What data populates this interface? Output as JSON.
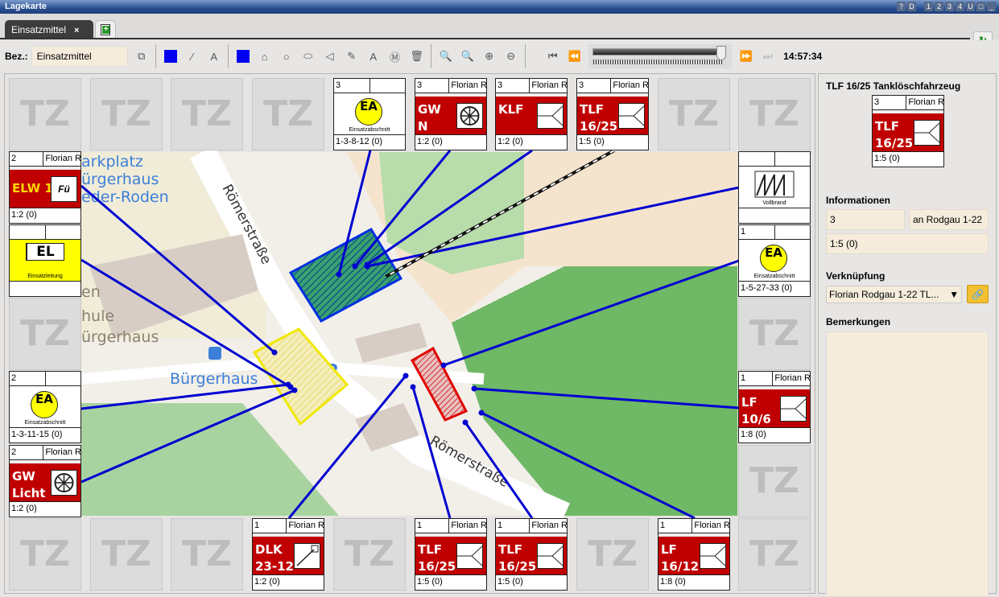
{
  "window": {
    "title": "Lagekarte",
    "buttons": [
      "?",
      "D",
      "1",
      "2",
      "3",
      "4",
      "U",
      "□",
      "_"
    ]
  },
  "tabs": [
    {
      "label": "Einsatzmittel",
      "close": "×"
    }
  ],
  "toolbar": {
    "bez_label": "Bez.:",
    "bez_value": "Einsatzmittel",
    "time": "14:57:34",
    "timeline_position_pct": 96,
    "icons": [
      "copy-add",
      "fill-color",
      "line-style",
      "text-style",
      "fill-color-2",
      "add-house",
      "add-circle",
      "add-ellipse",
      "add-triangle",
      "add-pen",
      "add-text",
      "add-marker",
      "delete",
      "zoom-fit",
      "zoom-1to1",
      "zoom-in",
      "zoom-out"
    ]
  },
  "grid": {
    "top": [
      {
        "t": "tz"
      },
      {
        "t": "tz"
      },
      {
        "t": "tz"
      },
      {
        "t": "tz"
      },
      {
        "t": "ea",
        "num": "3",
        "sub": "Einsatzabschnitt",
        "label": "EA",
        "foot": "1-3-8-12 (0)"
      },
      {
        "t": "veh",
        "num": "3",
        "unit": "Florian R",
        "name": "GW\nN",
        "sym": "wheel",
        "foot": "1:2 (0)"
      },
      {
        "t": "veh",
        "num": "3",
        "unit": "Florian R",
        "name": "KLF",
        "sym": "pump",
        "foot": "1:2 (0)"
      },
      {
        "t": "veh",
        "num": "3",
        "unit": "Florian R",
        "name": "TLF\n16/25",
        "sym": "pump",
        "foot": "1:5 (0)"
      },
      {
        "t": "tz"
      },
      {
        "t": "tz"
      }
    ],
    "left": [
      {
        "t": "veh",
        "num": "2",
        "unit": "Florian R",
        "name": "ELW 1",
        "sym": "fu",
        "symtext": "Fü",
        "foot": "1:2 (0)"
      },
      {
        "t": "el",
        "label": "EL",
        "sub": "Einsatzleitung"
      },
      {
        "t": "tz"
      },
      {
        "t": "ea",
        "num": "2",
        "sub": "Einsatzabschnitt",
        "label": "EA",
        "foot": "1-3-11-15 (0)"
      },
      {
        "t": "veh",
        "num": "2",
        "unit": "Florian R",
        "name": "GW\nLicht",
        "sym": "wheel",
        "foot": "1:2 (0)"
      }
    ],
    "right": [
      {
        "t": "fire",
        "sub": "Vollbrand"
      },
      {
        "t": "ea",
        "num": "1",
        "sub": "Einsatzabschnitt",
        "label": "EA",
        "foot": "1-5-27-33 (0)"
      },
      {
        "t": "tz"
      },
      {
        "t": "veh",
        "num": "1",
        "unit": "Florian R",
        "name": "LF\n10/6",
        "sym": "pump",
        "foot": "1:8 (0)"
      },
      {
        "t": "tz"
      }
    ],
    "bottom": [
      {
        "t": "tz"
      },
      {
        "t": "tz"
      },
      {
        "t": "tz"
      },
      {
        "t": "veh",
        "num": "1",
        "unit": "Florian R",
        "name": "DLK\n23-12",
        "sym": "ladder",
        "foot": "1:2 (0)"
      },
      {
        "t": "tz"
      },
      {
        "t": "veh",
        "num": "1",
        "unit": "Florian R",
        "name": "TLF\n16/25",
        "sym": "pump",
        "foot": "1:5 (0)"
      },
      {
        "t": "veh",
        "num": "1",
        "unit": "Florian R",
        "name": "TLF\n16/25",
        "sym": "pump",
        "foot": "1:5 (0)"
      },
      {
        "t": "tz"
      },
      {
        "t": "veh",
        "num": "1",
        "unit": "Florian R",
        "name": "LF\n16/12",
        "sym": "pump",
        "foot": "1:8 (0)"
      },
      {
        "t": "tz"
      }
    ],
    "tz_label": "TZ"
  },
  "map": {
    "labels": [
      "arkplatz",
      "ürgerhaus",
      "eder-Roden",
      "Römerstraße",
      "Römerstraße",
      "Bürgerhaus",
      "P",
      "hule",
      "ürgerhaus",
      "en"
    ]
  },
  "side": {
    "title": "TLF 16/25 Tanklöschfahrzeug",
    "card": {
      "t": "veh",
      "num": "3",
      "unit": "Florian R",
      "name": "TLF\n16/25",
      "sym": "pump",
      "foot": "1:5 (0)"
    },
    "info_label": "Informationen",
    "info_num": "3",
    "info_unit": "an Rodgau 1-22",
    "info_strength": "1:5 (0)",
    "link_label": "Verknüpfung",
    "link_value": "Florian Rodgau 1-22 TL...",
    "notes_label": "Bemerkungen",
    "notes_value": ""
  },
  "colors": {
    "vehicle": "#c00000",
    "ea": "#ffff00",
    "lines": "#0000d0",
    "titlebar": "#284f92"
  }
}
